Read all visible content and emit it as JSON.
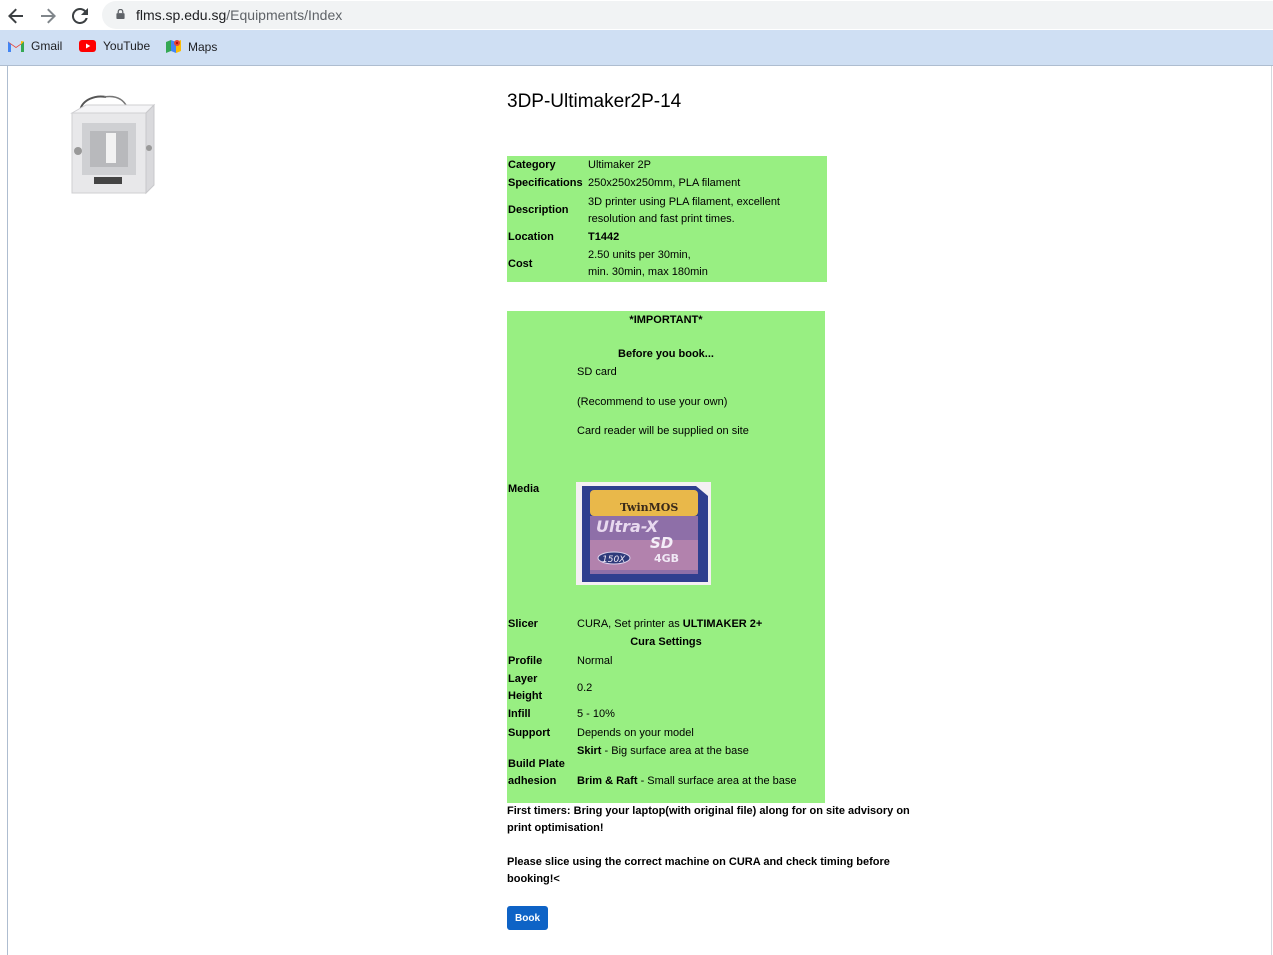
{
  "browser": {
    "url_domain": "flms.sp.edu.sg",
    "url_path": "/Equipments/Index",
    "bookmarks": [
      {
        "label": "Gmail"
      },
      {
        "label": "YouTube"
      },
      {
        "label": "Maps"
      }
    ]
  },
  "equipment": {
    "title": "3DP-Ultimaker2P-14",
    "specs": {
      "category_label": "Category",
      "category_value": "Ultimaker 2P",
      "specifications_label": "Specifications",
      "specifications_value": "250x250x250mm, PLA filament",
      "description_label": "Description",
      "description_line1": "3D printer using PLA filament, excellent",
      "description_line2": "resolution and fast print times.",
      "location_label": "Location",
      "location_value": "T1442",
      "cost_label": "Cost",
      "cost_line1": "2.50 units per 30min,",
      "cost_line2": "min. 30min, max 180min"
    }
  },
  "important": {
    "heading": "*IMPORTANT*",
    "before_heading": "Before you book...",
    "media_label": "Media",
    "media_lines": [
      "SD card",
      "(Recommend to use your own)",
      "Card reader will be supplied on site"
    ],
    "sd_card_brand": "TwinMOS",
    "sd_card_model": "Ultra-X",
    "sd_card_type": "SD",
    "sd_card_speed": "150X",
    "sd_card_capacity": "4GB",
    "slicer_label": "Slicer",
    "slicer_value_prefix": "CURA, Set printer as ",
    "slicer_value_bold": "ULTIMAKER 2+",
    "cura_heading": "Cura Settings",
    "profile_label": "Profile",
    "profile_value": "Normal",
    "layer_label_line1": "Layer",
    "layer_label_line2": "Height",
    "layer_value": "0.2",
    "infill_label": "Infill",
    "infill_value": "5 - 10%",
    "support_label": "Support",
    "support_value": "Depends on your model",
    "adhesion_label_line1": "Build Plate",
    "adhesion_label_line2": "adhesion",
    "skirt_bold": "Skirt",
    "skirt_text": " - Big surface area at the base",
    "brim_bold": "Brim & Raft",
    "brim_text": " - Small surface area at the base"
  },
  "notes": {
    "first_timers": "First timers: Bring your laptop(with original file)  along for on site advisory on print optimisation!",
    "slice_note": "Please slice using the correct machine on CURA and check timing before booking!<"
  },
  "actions": {
    "book_label": "Book"
  },
  "colors": {
    "highlight_green": "#98ef82",
    "book_button_blue": "#0e63c6",
    "bookmark_bar": "#cfdff3"
  }
}
